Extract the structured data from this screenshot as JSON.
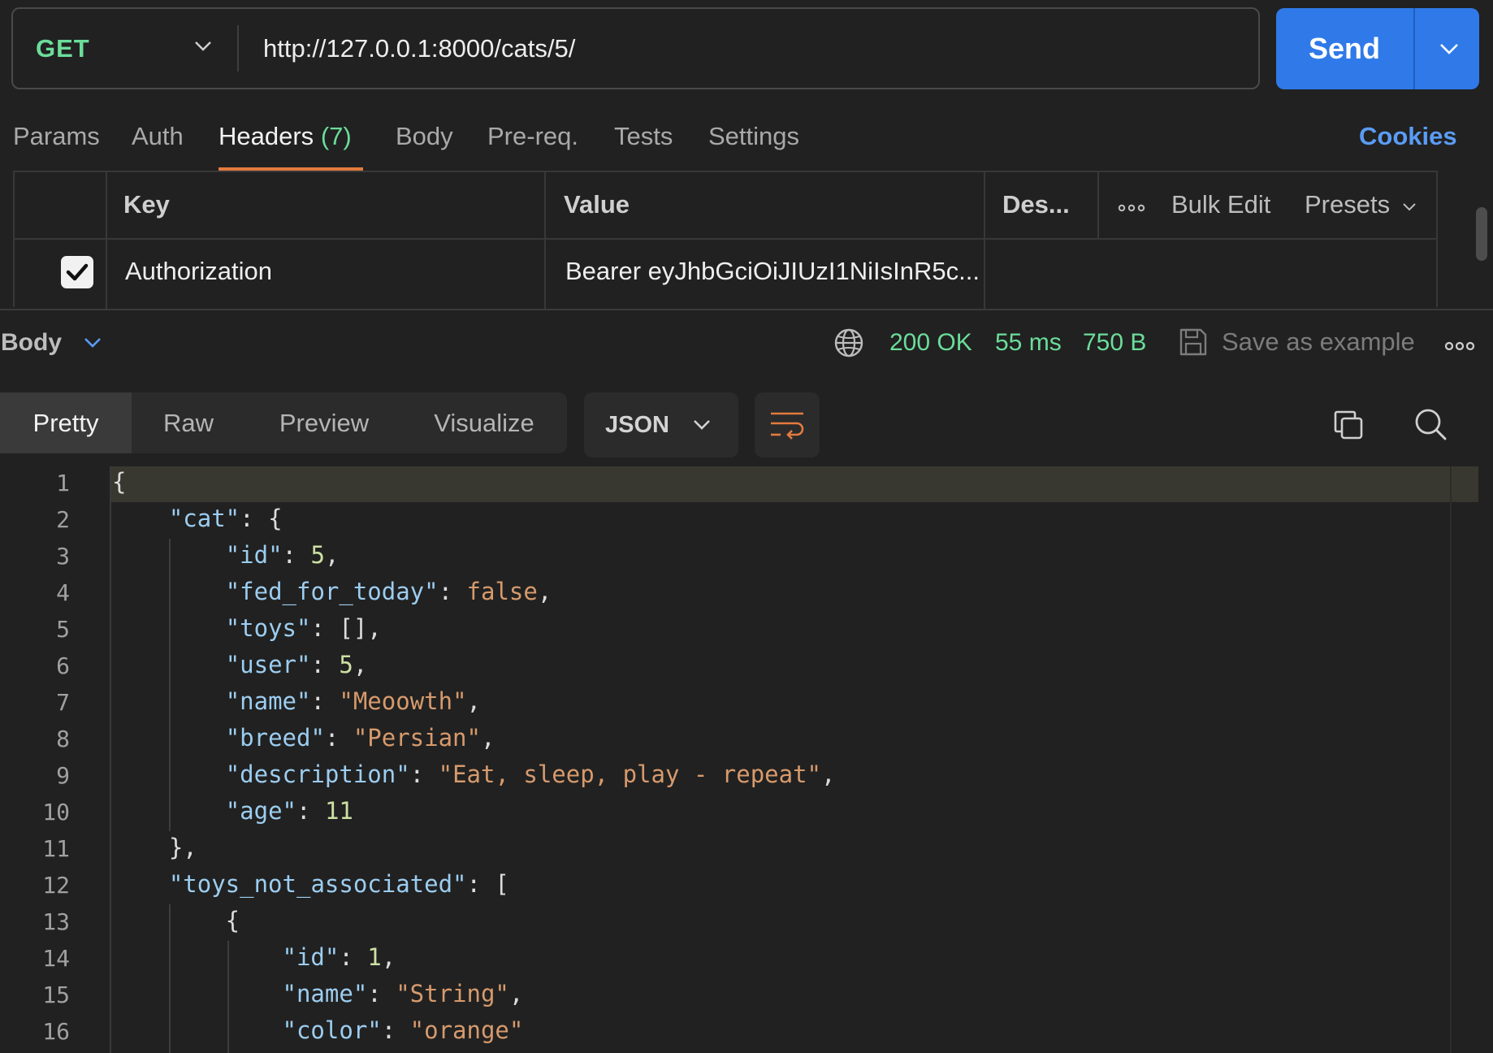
{
  "request": {
    "method": "GET",
    "url": "http://127.0.0.1:8000/cats/5/",
    "send_label": "Send"
  },
  "request_tabs": [
    {
      "label": "Params",
      "count": ""
    },
    {
      "label": "Auth",
      "count": ""
    },
    {
      "label": "Headers",
      "count": "(7)"
    },
    {
      "label": "Body",
      "count": ""
    },
    {
      "label": "Pre-req.",
      "count": ""
    },
    {
      "label": "Tests",
      "count": ""
    },
    {
      "label": "Settings",
      "count": ""
    }
  ],
  "active_request_tab": "Headers",
  "cookies_label": "Cookies",
  "headers_table": {
    "columns": {
      "key": "Key",
      "value": "Value",
      "description": "Des..."
    },
    "tools": {
      "bulk_edit": "Bulk Edit",
      "presets": "Presets"
    },
    "rows": [
      {
        "checked": true,
        "key": "Authorization",
        "value": "Bearer eyJhbGciOiJIUzI1NiIsInR5c..."
      }
    ]
  },
  "response": {
    "section_label": "Body",
    "status": "200 OK",
    "time": "55 ms",
    "size": "750 B",
    "save_label": "Save as example",
    "view_tabs": [
      "Pretty",
      "Raw",
      "Preview",
      "Visualize"
    ],
    "active_view": "Pretty",
    "format": "JSON",
    "code_lines": [
      "{",
      "    \"cat\": {",
      "        \"id\": 5,",
      "        \"fed_for_today\": false,",
      "        \"toys\": [],",
      "        \"user\": 5,",
      "        \"name\": \"Meoowth\",",
      "        \"breed\": \"Persian\",",
      "        \"description\": \"Eat, sleep, play - repeat\",",
      "        \"age\": 11",
      "    },",
      "    \"toys_not_associated\": [",
      "        {",
      "            \"id\": 1,",
      "            \"name\": \"String\",",
      "            \"color\": \"orange\""
    ]
  },
  "colors": {
    "accent_blue": "#2f7ae8",
    "method_green": "#6bdd9a",
    "tab_underline": "#e27b3e",
    "json_key": "#9ccdf0",
    "json_string": "#d79a6c",
    "json_number": "#cde0a4"
  }
}
